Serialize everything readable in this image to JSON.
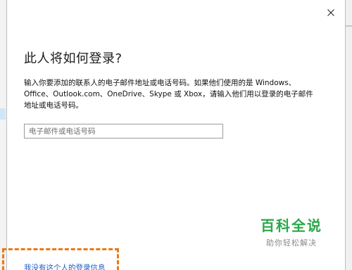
{
  "dialog": {
    "title": "此人将如何登录?",
    "description": "输入你要添加的联系人的电子邮件地址或电话号码。如果他们使用的是 Windows、Office、Outlook.com、OneDrive、Skype 或 Xbox，请输入他们用以登录的电子邮件地址或电话号码。",
    "input": {
      "placeholder": "电子邮件或电话号码",
      "value": ""
    },
    "no_info_link": "我没有这个人的登录信息",
    "close_icon": "close-icon"
  },
  "watermark": {
    "main": "百科全说",
    "sub": "助你轻松解决"
  },
  "colors": {
    "link": "#1a5ec8",
    "highlight": "#ea7a16",
    "watermark_green": "#2aa84a"
  }
}
